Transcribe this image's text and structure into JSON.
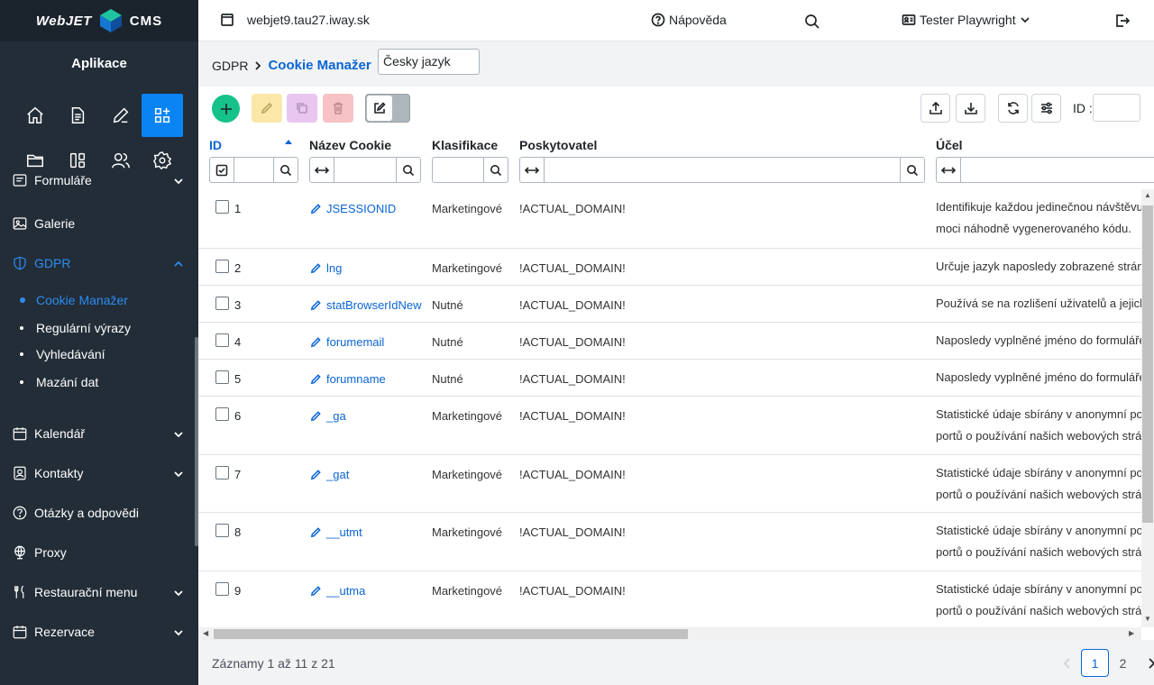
{
  "sidebar": {
    "logo_left": "WebJET",
    "logo_right": "CMS",
    "app_title": "Aplikace",
    "app_icons": [
      "home-icon",
      "document-icon",
      "pencil-icon",
      "apps-icon",
      "folder-icon",
      "layout-icon",
      "users-icon",
      "gear-icon"
    ],
    "items": [
      {
        "label": "Formuláře"
      },
      {
        "label": "Galerie"
      },
      {
        "label": "GDPR"
      },
      {
        "label": "Kalendář"
      },
      {
        "label": "Kontakty"
      },
      {
        "label": "Otázky a odpovědi"
      },
      {
        "label": "Proxy"
      },
      {
        "label": "Restaurační menu"
      },
      {
        "label": "Rezervace"
      }
    ],
    "gdpr_sub": [
      {
        "label": "Cookie Manažer"
      },
      {
        "label": "Regulární výrazy"
      },
      {
        "label": "Vyhledávání"
      },
      {
        "label": "Mazání dat"
      }
    ]
  },
  "header": {
    "domain": "webjet9.tau27.iway.sk",
    "help": "Nápověda",
    "user": "Tester Playwright"
  },
  "breadcrumb": {
    "parent": "GDPR",
    "current": "Cookie Manažer",
    "language": "Česky jazyk"
  },
  "toolbar": {
    "id_label": "ID :"
  },
  "table": {
    "columns": {
      "id": "ID",
      "name": "Název Cookie",
      "klas": "Klasifikace",
      "prov": "Poskytovatel",
      "ucel": "Účel"
    },
    "rows": [
      {
        "id": "1",
        "name": "JSESSIONID",
        "klas": "Marketingové",
        "prov": "!ACTUAL_DOMAIN!",
        "ucel1": "Identifikuje každou jedinečnou návštěvu",
        "ucel2": "moci náhodně vygenerovaného kódu."
      },
      {
        "id": "2",
        "name": "lng",
        "klas": "Marketingové",
        "prov": "!ACTUAL_DOMAIN!",
        "ucel1": "Určuje jazyk naposledy zobrazené stránky",
        "ucel2": ""
      },
      {
        "id": "3",
        "name": "statBrowserIdNew",
        "klas": "Nutné",
        "prov": "!ACTUAL_DOMAIN!",
        "ucel1": "Používá se na rozlišení uživatelů a jejich",
        "ucel2": ""
      },
      {
        "id": "4",
        "name": "forumemail",
        "klas": "Nutné",
        "prov": "!ACTUAL_DOMAIN!",
        "ucel1": "Naposledy vyplněné jméno do formuláře",
        "ucel2": ""
      },
      {
        "id": "5",
        "name": "forumname",
        "klas": "Nutné",
        "prov": "!ACTUAL_DOMAIN!",
        "ucel1": "Naposledy vyplněné jméno do formuláře",
        "ucel2": ""
      },
      {
        "id": "6",
        "name": "_ga",
        "klas": "Marketingové",
        "prov": "!ACTUAL_DOMAIN!",
        "ucel1": "Statistické údaje sbírány v anonymní podobě",
        "ucel2": "portů o používání našich webových stránek"
      },
      {
        "id": "7",
        "name": "_gat",
        "klas": "Marketingové",
        "prov": "!ACTUAL_DOMAIN!",
        "ucel1": "Statistické údaje sbírány v anonymní podobě",
        "ucel2": "portů o používání našich webových stránek"
      },
      {
        "id": "8",
        "name": "__utmt",
        "klas": "Marketingové",
        "prov": "!ACTUAL_DOMAIN!",
        "ucel1": "Statistické údaje sbírány v anonymní podobě",
        "ucel2": "portů o používání našich webových stránek"
      },
      {
        "id": "9",
        "name": "__utma",
        "klas": "Marketingové",
        "prov": "!ACTUAL_DOMAIN!",
        "ucel1": "Statistické údaje sbírány v anonymní podobě",
        "ucel2": "portů o používání našich webových stránek"
      }
    ]
  },
  "footer": {
    "info": "Záznamy 1 až 11 z 21",
    "pages": [
      "1",
      "2"
    ],
    "current_page": "1"
  }
}
